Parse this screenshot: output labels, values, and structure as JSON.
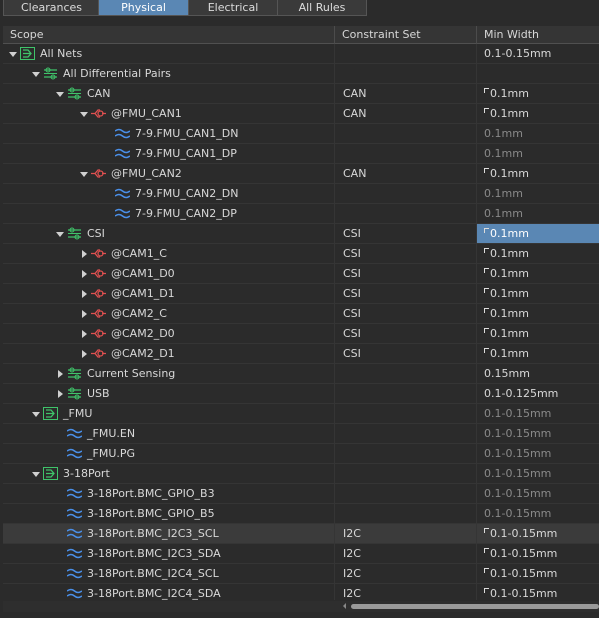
{
  "tabs": [
    "Clearances",
    "Physical",
    "Electrical",
    "All Rules"
  ],
  "active_tab": "Physical",
  "columns": {
    "scope": "Scope",
    "constraint_set": "Constraint Set",
    "min_width": "Min Width"
  },
  "colors": {
    "accent": "#5a87b4",
    "net_green": "#3fc46a",
    "diff_red": "#e05050",
    "net_blue": "#4a8fe8"
  },
  "rows": [
    {
      "indent": 0,
      "expander": "down",
      "icon": "net-class-icon",
      "label": "All Nets",
      "cset": "",
      "width": "0.1-0.15mm",
      "mark": false,
      "dim": false
    },
    {
      "indent": 1,
      "expander": "down",
      "icon": "diff-pair-class-icon",
      "label": "All Differential Pairs",
      "cset": "",
      "width": "",
      "mark": false,
      "dim": false
    },
    {
      "indent": 2,
      "expander": "down",
      "icon": "diff-pair-class-icon",
      "label": "CAN",
      "cset": "CAN",
      "width": "0.1mm",
      "mark": true,
      "dim": false
    },
    {
      "indent": 3,
      "expander": "down",
      "icon": "diff-pair-icon",
      "label": "@FMU_CAN1",
      "cset": "CAN",
      "width": "0.1mm",
      "mark": true,
      "dim": false
    },
    {
      "indent": 4,
      "expander": "",
      "icon": "net-icon",
      "label": "7-9.FMU_CAN1_DN",
      "cset": "",
      "width": "0.1mm",
      "mark": false,
      "dim": true
    },
    {
      "indent": 4,
      "expander": "",
      "icon": "net-icon",
      "label": "7-9.FMU_CAN1_DP",
      "cset": "",
      "width": "0.1mm",
      "mark": false,
      "dim": true
    },
    {
      "indent": 3,
      "expander": "down",
      "icon": "diff-pair-icon",
      "label": "@FMU_CAN2",
      "cset": "CAN",
      "width": "0.1mm",
      "mark": true,
      "dim": false
    },
    {
      "indent": 4,
      "expander": "",
      "icon": "net-icon",
      "label": "7-9.FMU_CAN2_DN",
      "cset": "",
      "width": "0.1mm",
      "mark": false,
      "dim": true
    },
    {
      "indent": 4,
      "expander": "",
      "icon": "net-icon",
      "label": "7-9.FMU_CAN2_DP",
      "cset": "",
      "width": "0.1mm",
      "mark": false,
      "dim": true
    },
    {
      "indent": 2,
      "expander": "down",
      "icon": "diff-pair-class-icon",
      "label": "CSI",
      "cset": "CSI",
      "width": "0.1mm",
      "mark": true,
      "dim": false,
      "selected": true
    },
    {
      "indent": 3,
      "expander": "right",
      "icon": "diff-pair-icon",
      "label": "@CAM1_C",
      "cset": "CSI",
      "width": "0.1mm",
      "mark": true,
      "dim": false
    },
    {
      "indent": 3,
      "expander": "right",
      "icon": "diff-pair-icon",
      "label": "@CAM1_D0",
      "cset": "CSI",
      "width": "0.1mm",
      "mark": true,
      "dim": false
    },
    {
      "indent": 3,
      "expander": "right",
      "icon": "diff-pair-icon",
      "label": "@CAM1_D1",
      "cset": "CSI",
      "width": "0.1mm",
      "mark": true,
      "dim": false
    },
    {
      "indent": 3,
      "expander": "right",
      "icon": "diff-pair-icon",
      "label": "@CAM2_C",
      "cset": "CSI",
      "width": "0.1mm",
      "mark": true,
      "dim": false
    },
    {
      "indent": 3,
      "expander": "right",
      "icon": "diff-pair-icon",
      "label": "@CAM2_D0",
      "cset": "CSI",
      "width": "0.1mm",
      "mark": true,
      "dim": false
    },
    {
      "indent": 3,
      "expander": "right",
      "icon": "diff-pair-icon",
      "label": "@CAM2_D1",
      "cset": "CSI",
      "width": "0.1mm",
      "mark": true,
      "dim": false
    },
    {
      "indent": 2,
      "expander": "right",
      "icon": "diff-pair-class-icon",
      "label": "Current Sensing",
      "cset": "",
      "width": "0.15mm",
      "mark": false,
      "dim": false
    },
    {
      "indent": 2,
      "expander": "right",
      "icon": "diff-pair-class-icon",
      "label": "USB",
      "cset": "",
      "width": "0.1-0.125mm",
      "mark": false,
      "dim": false
    },
    {
      "indent": 1,
      "expander": "down",
      "icon": "net-class-icon",
      "label": "_FMU",
      "cset": "",
      "width": "0.1-0.15mm",
      "mark": false,
      "dim": true
    },
    {
      "indent": 2,
      "expander": "",
      "icon": "net-icon",
      "label": "_FMU.EN",
      "cset": "",
      "width": "0.1-0.15mm",
      "mark": false,
      "dim": true
    },
    {
      "indent": 2,
      "expander": "",
      "icon": "net-icon",
      "label": "_FMU.PG",
      "cset": "",
      "width": "0.1-0.15mm",
      "mark": false,
      "dim": true
    },
    {
      "indent": 1,
      "expander": "down",
      "icon": "net-class-icon",
      "label": "3-18Port",
      "cset": "",
      "width": "0.1-0.15mm",
      "mark": false,
      "dim": true
    },
    {
      "indent": 2,
      "expander": "",
      "icon": "net-icon",
      "label": "3-18Port.BMC_GPIO_B3",
      "cset": "",
      "width": "0.1-0.15mm",
      "mark": false,
      "dim": true
    },
    {
      "indent": 2,
      "expander": "",
      "icon": "net-icon",
      "label": "3-18Port.BMC_GPIO_B5",
      "cset": "",
      "width": "0.1-0.15mm",
      "mark": false,
      "dim": true
    },
    {
      "indent": 2,
      "expander": "",
      "icon": "net-icon",
      "label": "3-18Port.BMC_I2C3_SCL",
      "cset": "I2C",
      "width": "0.1-0.15mm",
      "mark": true,
      "dim": false,
      "highlight": true
    },
    {
      "indent": 2,
      "expander": "",
      "icon": "net-icon",
      "label": "3-18Port.BMC_I2C3_SDA",
      "cset": "I2C",
      "width": "0.1-0.15mm",
      "mark": true,
      "dim": false
    },
    {
      "indent": 2,
      "expander": "",
      "icon": "net-icon",
      "label": "3-18Port.BMC_I2C4_SCL",
      "cset": "I2C",
      "width": "0.1-0.15mm",
      "mark": true,
      "dim": false
    },
    {
      "indent": 2,
      "expander": "",
      "icon": "net-icon",
      "label": "3-18Port.BMC_I2C4_SDA",
      "cset": "I2C",
      "width": "0.1-0.15mm",
      "mark": true,
      "dim": false
    }
  ]
}
